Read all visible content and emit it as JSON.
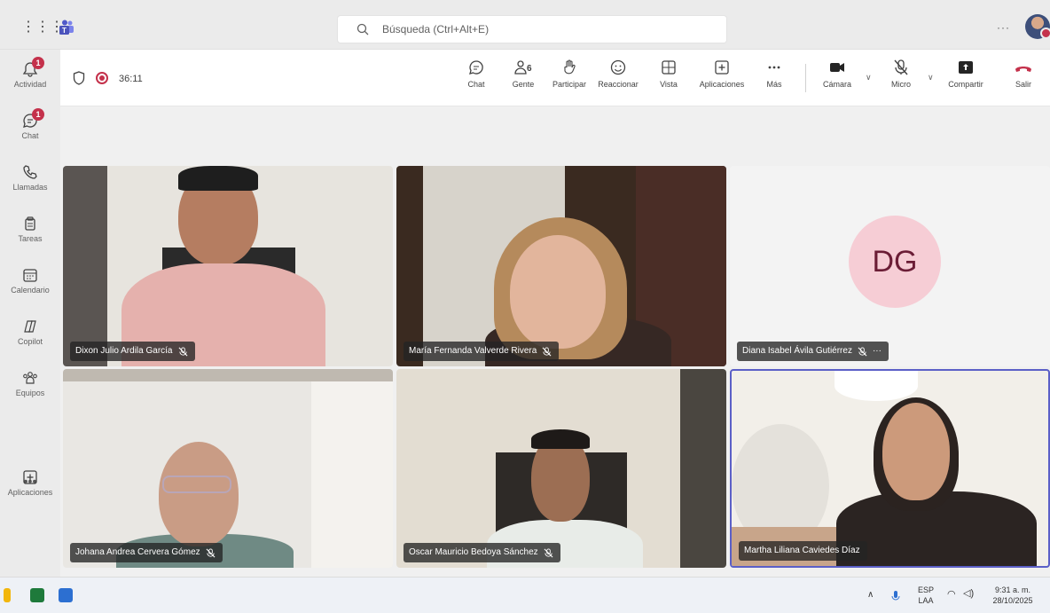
{
  "search": {
    "placeholder": "Búsqueda (Ctrl+Alt+E)"
  },
  "rail": {
    "items": [
      {
        "label": "Actividad",
        "badge": "1"
      },
      {
        "label": "Chat",
        "badge": "1"
      },
      {
        "label": "Llamadas"
      },
      {
        "label": "Tareas"
      },
      {
        "label": "Calendario"
      },
      {
        "label": "Copilot"
      },
      {
        "label": "Equipos"
      },
      {
        "label": "Aplicaciones"
      }
    ],
    "more": "•••"
  },
  "meeting": {
    "timer": "36:11",
    "people_count": "6",
    "tools": [
      {
        "label": "Chat"
      },
      {
        "label": "Gente"
      },
      {
        "label": "Participar"
      },
      {
        "label": "Reaccionar"
      },
      {
        "label": "Vista"
      },
      {
        "label": "Aplicaciones"
      },
      {
        "label": "Más"
      },
      {
        "label": "Cámara"
      },
      {
        "label": "Micro"
      },
      {
        "label": "Compartir"
      },
      {
        "label": "Salir"
      }
    ]
  },
  "participants": [
    {
      "name": "Dixon Julio Ardila García"
    },
    {
      "name": "María Fernanda Valverde Rivera"
    },
    {
      "name": "Diana Isabel Ávila Gutiérrez",
      "initials": "DG"
    },
    {
      "name": "Johana Andrea Cervera Gómez"
    },
    {
      "name": "Oscar Mauricio Bedoya Sánchez"
    },
    {
      "name": "Martha Liliana Caviedes Díaz"
    }
  ],
  "taskbar": {
    "lang_top": "ESP",
    "lang_bottom": "LAA",
    "time": "9:31 a. m.",
    "date": "28/10/2025"
  },
  "colors": {
    "accent": "#5b5fc7",
    "leave_red": "#c4314b",
    "badge_red": "#c4314b",
    "dg_avatar_bg": "#f6cdd5"
  }
}
